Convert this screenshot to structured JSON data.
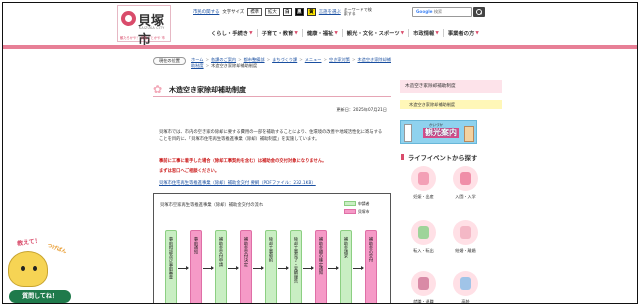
{
  "header": {
    "logo": {
      "city": "貝塚市",
      "romaji": "KAIZUKA CITY",
      "tagline": "観たろかや！ 文化ごとかや 市"
    },
    "util": {
      "links": [
        "市民の関する",
        "文字サイズ"
      ],
      "size_buttons": [
        "標準",
        "拡大"
      ],
      "color_chips": [
        "白",
        "黒",
        "黄"
      ],
      "lang_link": "言語を選ぶ",
      "keyword_hint": "キーワードで検索する"
    },
    "search": {
      "google": "Google",
      "placeholder": "検索"
    },
    "nav": [
      "くらし・手続き",
      "子育て・教育",
      "健康・福祉",
      "観光・文化・スポーツ",
      "市政情報",
      "事業者の方"
    ]
  },
  "breadcrumb": {
    "label": "現在の位置",
    "items": [
      "ホーム",
      "各課のご案内",
      "都市整備部",
      "まちづくり課",
      "メニュー",
      "空き家対策",
      "木造空き家除却補助制度"
    ],
    "current": "木造空き家除却補助制度"
  },
  "main": {
    "title": "木造空き家除却補助制度",
    "updated": "更新日：2025年07月21日",
    "body": "貝塚市では、市内の空き家の除却に要する費用の一部を補助することにより、住環境の改善や地域活性化に寄与することを目的に、「貝塚市住宅再生等推進事業（除却）補助制度」を実施しています。",
    "warnings": [
      "事前に工事に着手した場合（除却工事契約を含む）は補助金の交付対象になりません。",
      "まずは窓口へご相談ください。"
    ],
    "link": "貝塚市住宅再生等推進事業（除却）補助金交付 要綱（PDFファイル：232.1KB）"
  },
  "flow": {
    "title": "貝塚市空家再生等推進事業（除却）補助金交付の流れ",
    "legend": [
      "申請者",
      "貝塚市"
    ],
    "steps": [
      {
        "label": "事前相談及び事前審査",
        "actor": "g"
      },
      {
        "label": "事前通知",
        "actor": "p"
      },
      {
        "label": "補助金交付申請",
        "actor": "g"
      },
      {
        "label": "補助金交付決定",
        "actor": "p"
      },
      {
        "label": "除却工事契約",
        "actor": "g"
      },
      {
        "label": "除却工事完了・実績報告",
        "actor": "g"
      },
      {
        "label": "補助金額の確定通知",
        "actor": "p"
      },
      {
        "label": "補助金請求",
        "actor": "g"
      },
      {
        "label": "補助金の交付",
        "actor": "p"
      }
    ]
  },
  "sidebar": {
    "heading": "木造空き家除却補助制度",
    "items": [
      "木造空き家除却補助制度"
    ],
    "banner": {
      "small": "かいづか",
      "big": "観光案内"
    },
    "life_title": "ライフイベントから探す",
    "life_items": [
      {
        "label": "妊娠・出産",
        "icon": "pregnancy-icon"
      },
      {
        "label": "入園・入学",
        "icon": "school-entry-icon"
      },
      {
        "label": "転入・転出",
        "icon": "moving-truck-icon"
      },
      {
        "label": "結婚・離婚",
        "icon": "wedding-icon"
      },
      {
        "label": "就職・退職",
        "icon": "briefcase-icon"
      },
      {
        "label": "高齢",
        "icon": "elderly-icon"
      }
    ]
  },
  "mascot": {
    "bubble": "教えて！",
    "bubble2": "つげばん",
    "cta": "質問してね！"
  },
  "colors": {
    "brand_pink": "#d94c6b",
    "bar_pink": "#e77f96",
    "flow_green": "#c9eec3",
    "flow_pink": "#f59ac7",
    "warning_red": "#cc1d1d",
    "link_blue": "#1a4fa0"
  }
}
